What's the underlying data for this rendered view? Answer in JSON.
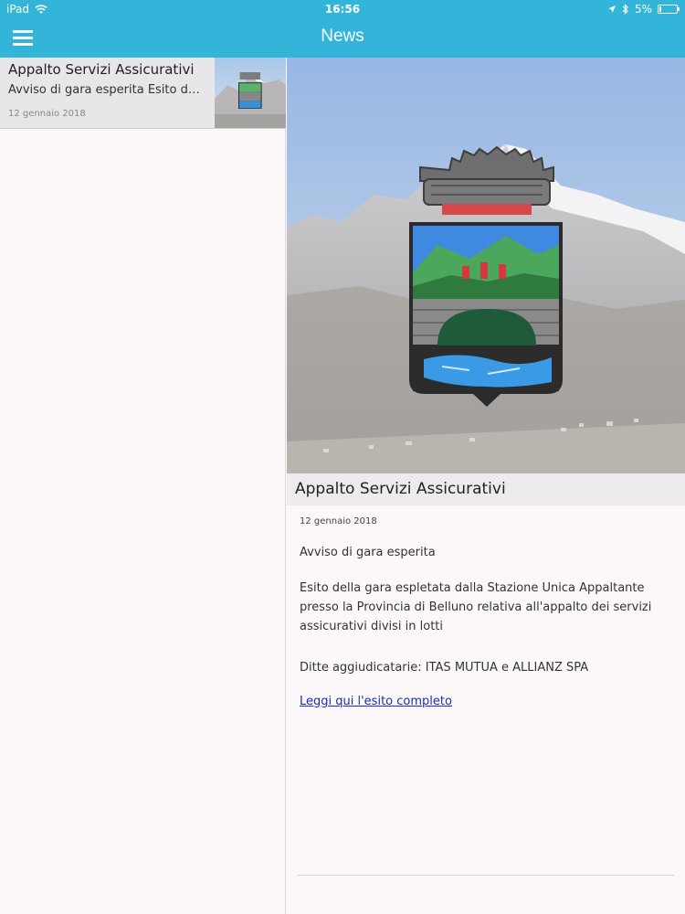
{
  "status_bar": {
    "device": "iPad",
    "time": "16:56",
    "battery": "5%"
  },
  "nav": {
    "title": "News"
  },
  "list": {
    "items": [
      {
        "title": "Appalto Servizi Assicurativi",
        "summary": "Avviso di gara esperita  Esito della...",
        "date": "12 gennaio 2018"
      }
    ]
  },
  "detail": {
    "title": "Appalto Servizi Assicurativi",
    "date": "12 gennaio 2018",
    "paragraphs": [
      "Avviso di gara esperita",
      "Esito della gara espletata dalla Stazione Unica Appaltante presso la Provincia di Belluno relativa all'appalto dei servizi assicurativi divisi in lotti",
      "Ditte aggiudicatarie: ITAS MUTUA e ALLIANZ SPA"
    ],
    "link": "Leggi qui l'esito completo"
  },
  "icons": {
    "menu": "hamburger-menu-icon",
    "wifi": "wifi-icon",
    "location": "location-arrow-icon",
    "bluetooth": "bluetooth-icon",
    "battery": "battery-icon",
    "crest": "coat-of-arms-icon"
  },
  "colors": {
    "nav_bar": "#32b5d8",
    "link": "#1a2fb4"
  }
}
